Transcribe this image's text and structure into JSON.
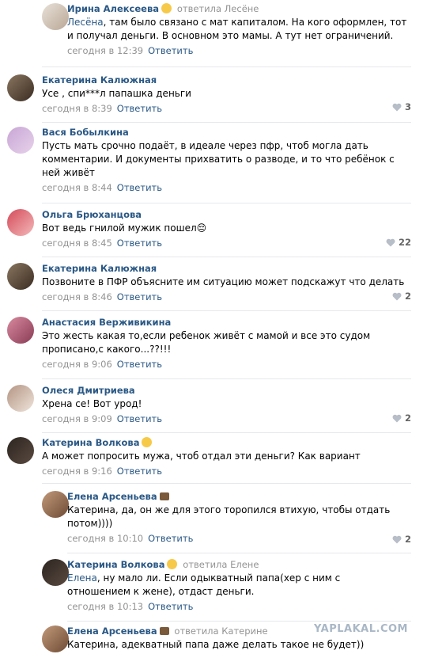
{
  "comments": [
    {
      "author": "Ирина Алексеева",
      "reply_to": "ответила Лесёне",
      "text_mention": "Лесёна",
      "text": ", там было связано с мат капиталом. На кого оформлен, тот и получал деньги. В основном это мамы. А тут нет ограничений.",
      "date": "сегодня в 12:39",
      "reply_label": "Ответить",
      "likes": ""
    },
    {
      "author": "Екатерина Калюжная",
      "text": "Усе , спи***л папашка деньги",
      "date": "сегодня в 8:39",
      "reply_label": "Ответить",
      "likes": "3"
    },
    {
      "author": "Вася Бобылкина",
      "text": "Пусть мать срочно подаёт, в идеале через пфр, чтоб могла дать комментарии. И документы прихватить о разводе, и то что ребёнок с ней живёт",
      "date": "сегодня в 8:44",
      "reply_label": "Ответить",
      "likes": ""
    },
    {
      "author": "Ольга Брюханцова",
      "text": "Вот ведь гнилой мужик пошел😔",
      "date": "сегодня в 8:45",
      "reply_label": "Ответить",
      "likes": "22"
    },
    {
      "author": "Екатерина Калюжная",
      "text": "Позвоните в ПФР объясните им ситуацию может подскажут что делать",
      "date": "сегодня в 8:46",
      "reply_label": "Ответить",
      "likes": "2"
    },
    {
      "author": "Анастасия Верживикина",
      "text": "Это жесть какая то,если ребенок живёт с мамой и все это судом прописано,с какого...??!!!",
      "date": "сегодня в 9:06",
      "reply_label": "Ответить",
      "likes": ""
    },
    {
      "author": "Олеся Дмитриева",
      "text": "Хрена се! Вот урод!",
      "date": "сегодня в 9:09",
      "reply_label": "Ответить",
      "likes": "2"
    },
    {
      "author": "Катерина Волкова",
      "text": "А может попросить мужа, чтоб отдал эти деньги? Как вариант",
      "date": "сегодня в 9:16",
      "reply_label": "Ответить",
      "likes": ""
    },
    {
      "author": "Елена Арсеньева",
      "text": "Катерина, да, он же для этого торопился втихую, чтобы отдать потом))))",
      "date": "сегодня в 10:10",
      "reply_label": "Ответить",
      "likes": "2"
    },
    {
      "author": "Катерина Волкова",
      "reply_to": "ответила Елене",
      "text_mention": "Елена",
      "text": ", ну мало ли. Если одыкватный папа(хер с ним с отношением к жене), отдаст деньги.",
      "date": "сегодня в 10:13",
      "reply_label": "Ответить",
      "likes": ""
    },
    {
      "author": "Елена Арсеньева",
      "reply_to": "ответила Катерине",
      "text": "Катерина, адекватный папа даже делать такое не будет))",
      "date": "",
      "reply_label": "",
      "likes": ""
    }
  ],
  "watermark": "YAPLAKAL.COM",
  "colors": {
    "author": "#2a5885",
    "meta": "#939393",
    "divider": "#e7e8ec",
    "likes": "#656565"
  }
}
